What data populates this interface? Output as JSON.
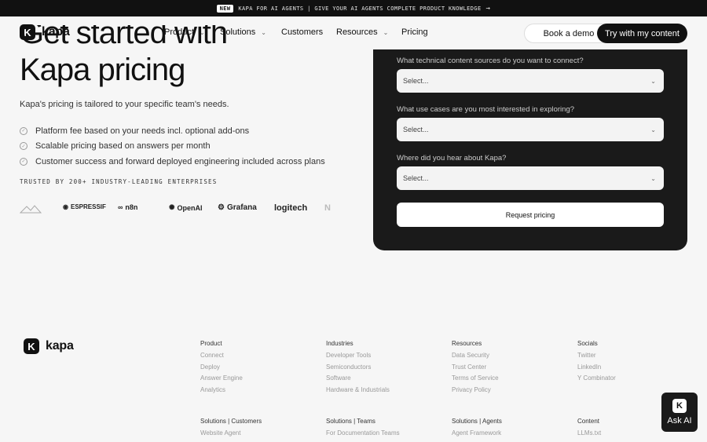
{
  "announcement": {
    "badge": "NEW",
    "text": "KAPA FOR AI AGENTS | GIVE YOUR AI AGENTS COMPLETE PRODUCT KNOWLEDGE",
    "arrow_icon": "arrow-right-icon"
  },
  "nav": {
    "brand": "kapa",
    "brand_mark": "K",
    "links": [
      {
        "label": "Product",
        "dropdown": true
      },
      {
        "label": "Solutions",
        "dropdown": true
      },
      {
        "label": "Customers",
        "dropdown": false
      },
      {
        "label": "Resources",
        "dropdown": true
      },
      {
        "label": "Pricing",
        "dropdown": false
      }
    ],
    "book_demo": "Book a demo",
    "try_content": "Try with my content"
  },
  "hero": {
    "title_line1": "Get started with",
    "title_line2": "Kapa pricing",
    "subtitle": "Kapa's pricing is tailored to your specific team's needs.",
    "bullets": [
      "Platform fee based on your needs incl. optional add-ons",
      "Scalable pricing based on answers per month",
      "Customer success and forward deployed engineering included across plans"
    ],
    "trusted": "TRUSTED BY 200+ INDUSTRY-LEADING ENTERPRISES",
    "logos": [
      {
        "name": "",
        "icon": "mountain-logo-icon"
      },
      {
        "name": "ESPRESSIF",
        "icon": "espressif-logo-icon"
      },
      {
        "name": "n8n",
        "icon": "n8n-logo-icon"
      },
      {
        "name": "OpenAI",
        "icon": "openai-logo-icon"
      },
      {
        "name": "Grafana",
        "icon": "grafana-logo-icon"
      },
      {
        "name": "logitech",
        "icon": ""
      },
      {
        "name": "",
        "icon": "n-logo-icon"
      }
    ]
  },
  "form": {
    "questions": [
      {
        "label": "What technical content sources do you want to connect?",
        "value": "Select..."
      },
      {
        "label": "What use cases are you most interested in exploring?",
        "value": "Select..."
      },
      {
        "label": "Where did you hear about Kapa?",
        "value": "Select..."
      }
    ],
    "submit": "Request pricing"
  },
  "footer": {
    "brand": "kapa",
    "brand_mark": "K",
    "columns": [
      {
        "heading": "Product",
        "items": [
          "Connect",
          "Deploy",
          "Answer Engine",
          "Analytics"
        ]
      },
      {
        "heading": "Industries",
        "items": [
          "Developer Tools",
          "Semiconductors",
          "Software",
          "Hardware & Industrials"
        ]
      },
      {
        "heading": "Resources",
        "items": [
          "Data Security",
          "Trust Center",
          "Terms of Service",
          "Privacy Policy"
        ]
      },
      {
        "heading": "Socials",
        "items": [
          "Twitter",
          "LinkedIn",
          "Y Combinator"
        ]
      },
      {
        "heading": "Solutions | Customers",
        "items": [
          "Website Agent"
        ]
      },
      {
        "heading": "Solutions | Teams",
        "items": [
          "For Documentation Teams"
        ]
      },
      {
        "heading": "Solutions | Agents",
        "items": [
          "Agent Framework"
        ]
      },
      {
        "heading": "Content",
        "items": [
          "LLMs.txt"
        ]
      }
    ]
  },
  "ask_ai": {
    "label": "Ask AI",
    "mark": "K"
  },
  "colors": {
    "dark": "#1a1a1a",
    "background": "#f6f6f6",
    "muted_text": "#999999"
  }
}
